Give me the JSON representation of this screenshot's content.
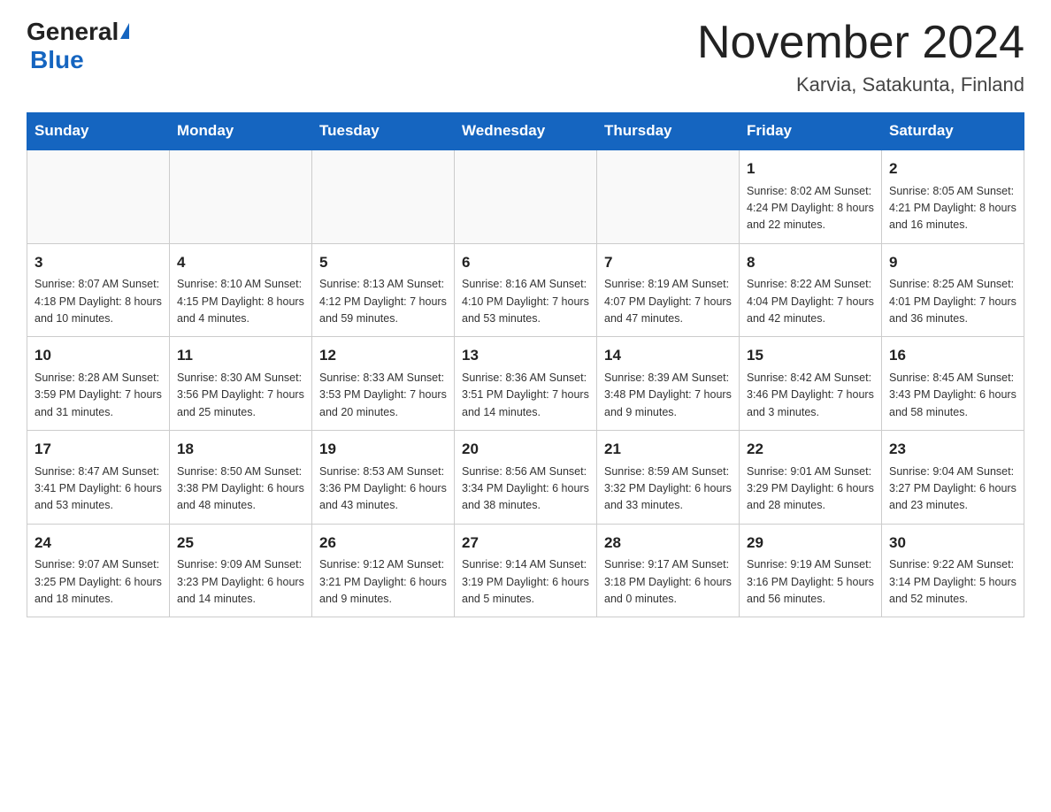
{
  "header": {
    "logo_general": "General",
    "logo_blue": "Blue",
    "title": "November 2024",
    "subtitle": "Karvia, Satakunta, Finland"
  },
  "days_of_week": [
    "Sunday",
    "Monday",
    "Tuesday",
    "Wednesday",
    "Thursday",
    "Friday",
    "Saturday"
  ],
  "weeks": [
    [
      {
        "day": "",
        "info": ""
      },
      {
        "day": "",
        "info": ""
      },
      {
        "day": "",
        "info": ""
      },
      {
        "day": "",
        "info": ""
      },
      {
        "day": "",
        "info": ""
      },
      {
        "day": "1",
        "info": "Sunrise: 8:02 AM\nSunset: 4:24 PM\nDaylight: 8 hours\nand 22 minutes."
      },
      {
        "day": "2",
        "info": "Sunrise: 8:05 AM\nSunset: 4:21 PM\nDaylight: 8 hours\nand 16 minutes."
      }
    ],
    [
      {
        "day": "3",
        "info": "Sunrise: 8:07 AM\nSunset: 4:18 PM\nDaylight: 8 hours\nand 10 minutes."
      },
      {
        "day": "4",
        "info": "Sunrise: 8:10 AM\nSunset: 4:15 PM\nDaylight: 8 hours\nand 4 minutes."
      },
      {
        "day": "5",
        "info": "Sunrise: 8:13 AM\nSunset: 4:12 PM\nDaylight: 7 hours\nand 59 minutes."
      },
      {
        "day": "6",
        "info": "Sunrise: 8:16 AM\nSunset: 4:10 PM\nDaylight: 7 hours\nand 53 minutes."
      },
      {
        "day": "7",
        "info": "Sunrise: 8:19 AM\nSunset: 4:07 PM\nDaylight: 7 hours\nand 47 minutes."
      },
      {
        "day": "8",
        "info": "Sunrise: 8:22 AM\nSunset: 4:04 PM\nDaylight: 7 hours\nand 42 minutes."
      },
      {
        "day": "9",
        "info": "Sunrise: 8:25 AM\nSunset: 4:01 PM\nDaylight: 7 hours\nand 36 minutes."
      }
    ],
    [
      {
        "day": "10",
        "info": "Sunrise: 8:28 AM\nSunset: 3:59 PM\nDaylight: 7 hours\nand 31 minutes."
      },
      {
        "day": "11",
        "info": "Sunrise: 8:30 AM\nSunset: 3:56 PM\nDaylight: 7 hours\nand 25 minutes."
      },
      {
        "day": "12",
        "info": "Sunrise: 8:33 AM\nSunset: 3:53 PM\nDaylight: 7 hours\nand 20 minutes."
      },
      {
        "day": "13",
        "info": "Sunrise: 8:36 AM\nSunset: 3:51 PM\nDaylight: 7 hours\nand 14 minutes."
      },
      {
        "day": "14",
        "info": "Sunrise: 8:39 AM\nSunset: 3:48 PM\nDaylight: 7 hours\nand 9 minutes."
      },
      {
        "day": "15",
        "info": "Sunrise: 8:42 AM\nSunset: 3:46 PM\nDaylight: 7 hours\nand 3 minutes."
      },
      {
        "day": "16",
        "info": "Sunrise: 8:45 AM\nSunset: 3:43 PM\nDaylight: 6 hours\nand 58 minutes."
      }
    ],
    [
      {
        "day": "17",
        "info": "Sunrise: 8:47 AM\nSunset: 3:41 PM\nDaylight: 6 hours\nand 53 minutes."
      },
      {
        "day": "18",
        "info": "Sunrise: 8:50 AM\nSunset: 3:38 PM\nDaylight: 6 hours\nand 48 minutes."
      },
      {
        "day": "19",
        "info": "Sunrise: 8:53 AM\nSunset: 3:36 PM\nDaylight: 6 hours\nand 43 minutes."
      },
      {
        "day": "20",
        "info": "Sunrise: 8:56 AM\nSunset: 3:34 PM\nDaylight: 6 hours\nand 38 minutes."
      },
      {
        "day": "21",
        "info": "Sunrise: 8:59 AM\nSunset: 3:32 PM\nDaylight: 6 hours\nand 33 minutes."
      },
      {
        "day": "22",
        "info": "Sunrise: 9:01 AM\nSunset: 3:29 PM\nDaylight: 6 hours\nand 28 minutes."
      },
      {
        "day": "23",
        "info": "Sunrise: 9:04 AM\nSunset: 3:27 PM\nDaylight: 6 hours\nand 23 minutes."
      }
    ],
    [
      {
        "day": "24",
        "info": "Sunrise: 9:07 AM\nSunset: 3:25 PM\nDaylight: 6 hours\nand 18 minutes."
      },
      {
        "day": "25",
        "info": "Sunrise: 9:09 AM\nSunset: 3:23 PM\nDaylight: 6 hours\nand 14 minutes."
      },
      {
        "day": "26",
        "info": "Sunrise: 9:12 AM\nSunset: 3:21 PM\nDaylight: 6 hours\nand 9 minutes."
      },
      {
        "day": "27",
        "info": "Sunrise: 9:14 AM\nSunset: 3:19 PM\nDaylight: 6 hours\nand 5 minutes."
      },
      {
        "day": "28",
        "info": "Sunrise: 9:17 AM\nSunset: 3:18 PM\nDaylight: 6 hours\nand 0 minutes."
      },
      {
        "day": "29",
        "info": "Sunrise: 9:19 AM\nSunset: 3:16 PM\nDaylight: 5 hours\nand 56 minutes."
      },
      {
        "day": "30",
        "info": "Sunrise: 9:22 AM\nSunset: 3:14 PM\nDaylight: 5 hours\nand 52 minutes."
      }
    ]
  ]
}
